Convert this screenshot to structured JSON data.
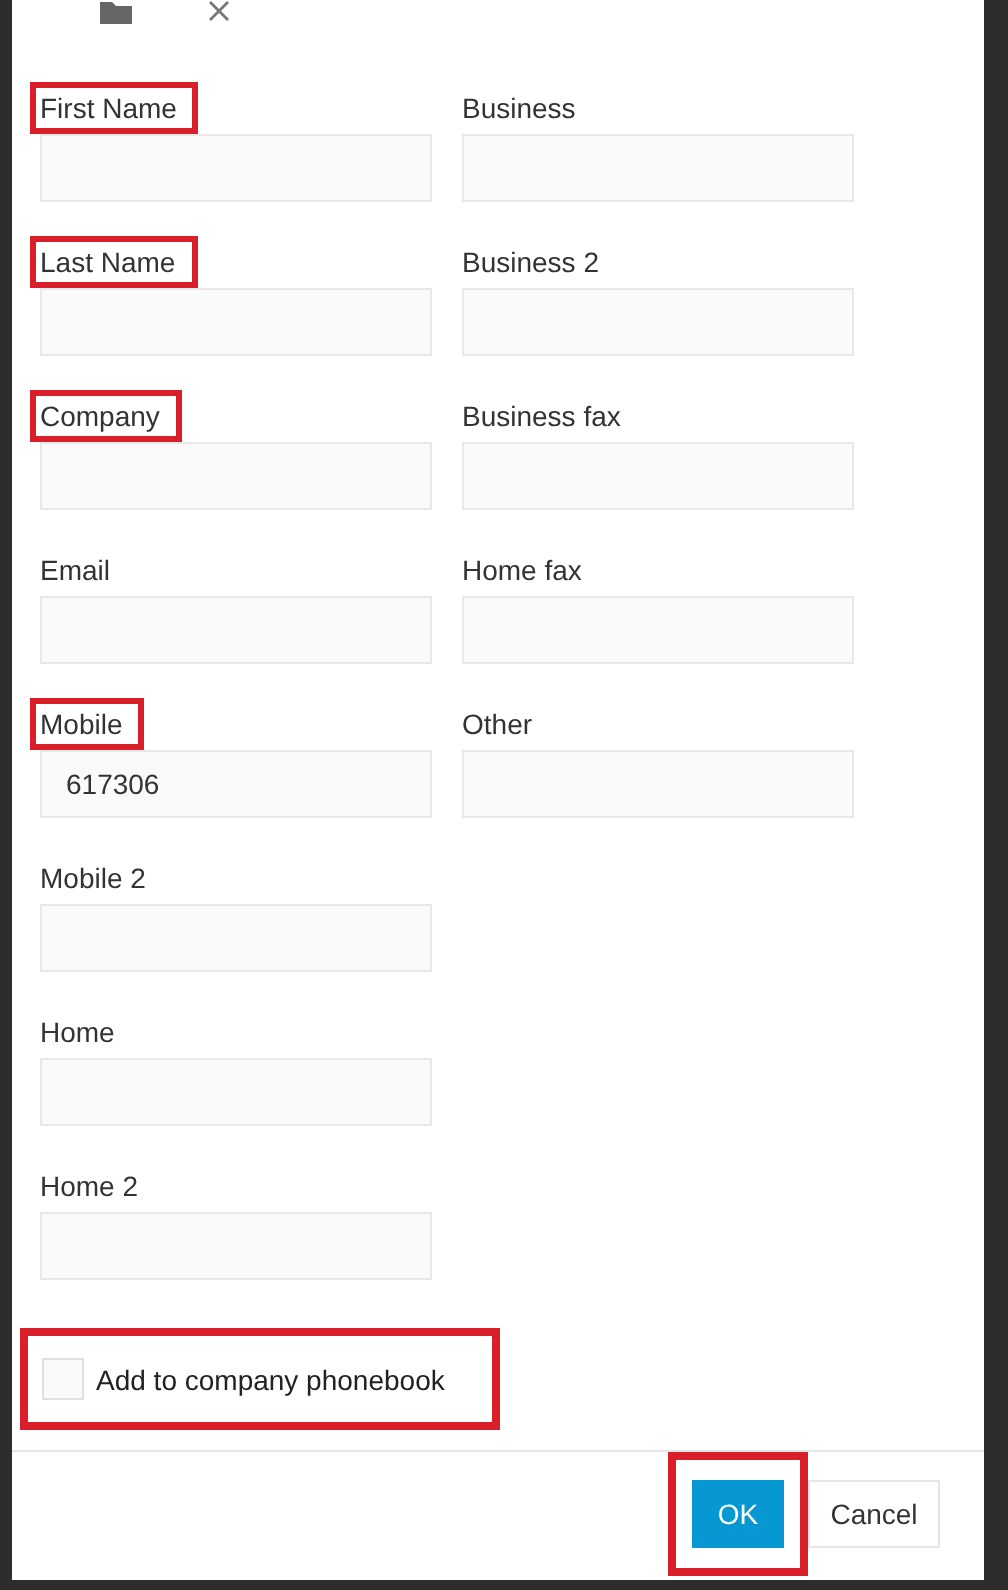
{
  "toolbar": {
    "icons": [
      {
        "kind": "folder"
      },
      {
        "kind": "close"
      }
    ]
  },
  "columns": [
    {
      "fields": [
        {
          "label": "First Name",
          "highlighted": true
        },
        {
          "label": "Last Name",
          "highlighted": true
        },
        {
          "label": "Company",
          "highlighted": true
        },
        {
          "label": "Email",
          "highlighted": false
        },
        {
          "label": "Mobile",
          "highlighted": true,
          "value": "617306"
        },
        {
          "label": "Mobile 2",
          "highlighted": false
        },
        {
          "label": "Home",
          "highlighted": false
        },
        {
          "label": "Home 2",
          "highlighted": false
        }
      ]
    },
    {
      "fields": [
        {
          "label": "Business",
          "highlighted": false
        },
        {
          "label": "Business 2",
          "highlighted": false
        },
        {
          "label": "Business fax",
          "highlighted": false
        },
        {
          "label": "Home fax",
          "highlighted": false
        },
        {
          "label": "Other",
          "highlighted": false
        }
      ]
    }
  ],
  "phonebook": {
    "label": "Add to company phonebook",
    "checked": false,
    "highlighted": true
  },
  "buttons": [
    {
      "label": "OK",
      "kind": "primary",
      "highlighted": true
    },
    {
      "label": "Cancel",
      "kind": "secondary",
      "highlighted": false
    }
  ]
}
